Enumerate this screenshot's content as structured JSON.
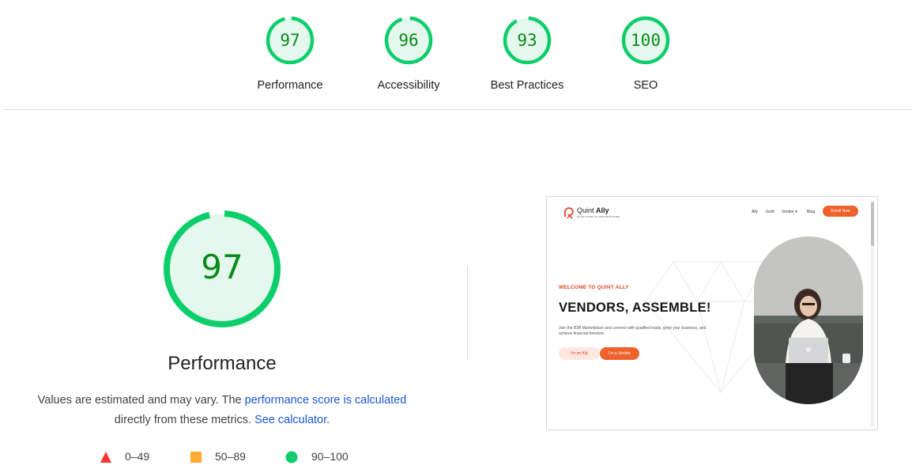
{
  "scores": [
    {
      "label": "Performance",
      "score": "97",
      "fraction": 0.97
    },
    {
      "label": "Accessibility",
      "score": "96",
      "fraction": 0.96
    },
    {
      "label": "Best Practices",
      "score": "93",
      "fraction": 0.93
    },
    {
      "label": "SEO",
      "score": "100",
      "fraction": 1.0
    }
  ],
  "performance": {
    "score": "97",
    "fraction": 0.97,
    "title": "Performance",
    "desc_prefix": "Values are estimated and may vary. The ",
    "link_score": "performance score is calculated",
    "desc_middle": " directly from these metrics. ",
    "link_calculator": "See calculator",
    "desc_suffix": "."
  },
  "legend": [
    {
      "range": "0–49",
      "shape": "triangle",
      "color": "#ff3333"
    },
    {
      "range": "50–89",
      "shape": "square",
      "color": "#ffaa33"
    },
    {
      "range": "90–100",
      "shape": "circle",
      "color": "#0cce6b"
    }
  ],
  "colors": {
    "pass": "#0cce6b",
    "pass_fill": "#e5f8ee",
    "pass_text": "#0b8a1a",
    "link": "#1a56d6",
    "brand_orange": "#f0622b"
  },
  "screenshot": {
    "brand_light": "Quint ",
    "brand_bold": "Ally",
    "tagline": "ECOSYSTEM OF OPPORTUNITIES",
    "nav": [
      "Ally",
      "Gold",
      "Vendor ▾",
      "Blog"
    ],
    "enroll": "Enroll Now",
    "welcome": "WELCOME TO QUINT ALLY",
    "headline": "VENDORS, ASSEMBLE!",
    "sub": "Join the B2B Marketplace and connect with qualified leads, grow your business, and achieve financial freedom.",
    "btn_ally": "I'm an Ally",
    "btn_vendor": "I'm a Vendor"
  }
}
